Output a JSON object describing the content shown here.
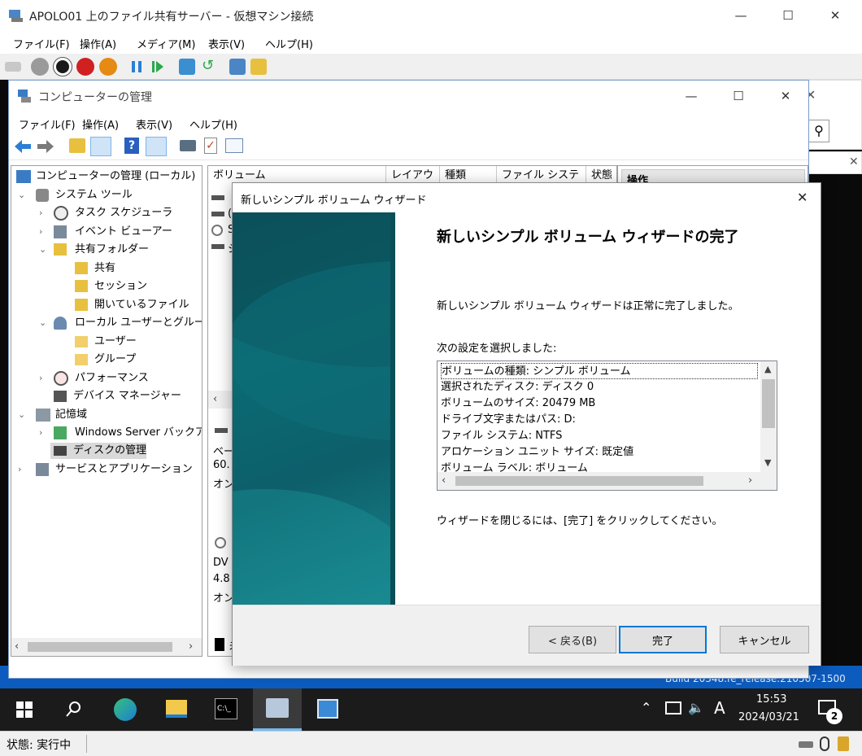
{
  "vm": {
    "title": "APOLO01 上のファイル共有サーバー - 仮想マシン接続",
    "menu": [
      "ファイル(F)",
      "操作(A)",
      "メディア(M)",
      "表示(V)",
      "ヘルプ(H)"
    ],
    "status": "状態: 実行中"
  },
  "cm": {
    "title": "コンピューターの管理",
    "menu": [
      "ファイル(F)",
      "操作(A)",
      "表示(V)",
      "ヘルプ(H)"
    ],
    "tree": [
      "コンピューターの管理 (ローカル)",
      "システム ツール",
      "タスク スケジューラ",
      "イベント ビューアー",
      "共有フォルダー",
      "共有",
      "セッション",
      "開いているファイル",
      "ローカル ユーザーとグループ",
      "ユーザー",
      "グループ",
      "パフォーマンス",
      "デバイス マネージャー",
      "記憶域",
      "Windows Server バックアップ",
      "ディスクの管理",
      "サービスとアプリケーション"
    ],
    "columns": [
      "ボリューム",
      "レイアウト",
      "種類",
      "ファイル システム",
      "状態"
    ],
    "actions_header": "操作",
    "volume_rows": [
      "(",
      "S",
      "シ"
    ],
    "disk0": [
      "ベー",
      "60.",
      "オン"
    ],
    "disk1": [
      "DV",
      "4.8",
      "オン"
    ],
    "legend": "未"
  },
  "wizard": {
    "title": "新しいシンプル ボリューム ウィザード",
    "heading": "新しいシンプル ボリューム ウィザードの完了",
    "message": "新しいシンプル ボリューム ウィザードは正常に完了しました。",
    "settings_label": "次の設定を選択しました:",
    "settings": [
      "ボリュームの種類: シンプル ボリューム",
      "選択されたディスク: ディスク 0",
      "ボリュームのサイズ: 20479 MB",
      "ドライブ文字またはパス: D:",
      "ファイル システム: NTFS",
      "アロケーション ユニット サイズ: 既定値",
      "ボリューム ラベル: ボリューム"
    ],
    "close_hint": "ウィザードを閉じるには、[完了] をクリックしてください。",
    "back_label": "< 戻る(B)",
    "finish_label": "完了",
    "cancel_label": "キャンセル"
  },
  "taskbar": {
    "time": "15:53",
    "date": "2024/03/21",
    "ime": "A",
    "notifications": "2",
    "build_text": "Build 20348.fe_release.210507-1500"
  },
  "colors": {
    "accent": "#0078d7",
    "wizard_side": "#0a6b74"
  }
}
